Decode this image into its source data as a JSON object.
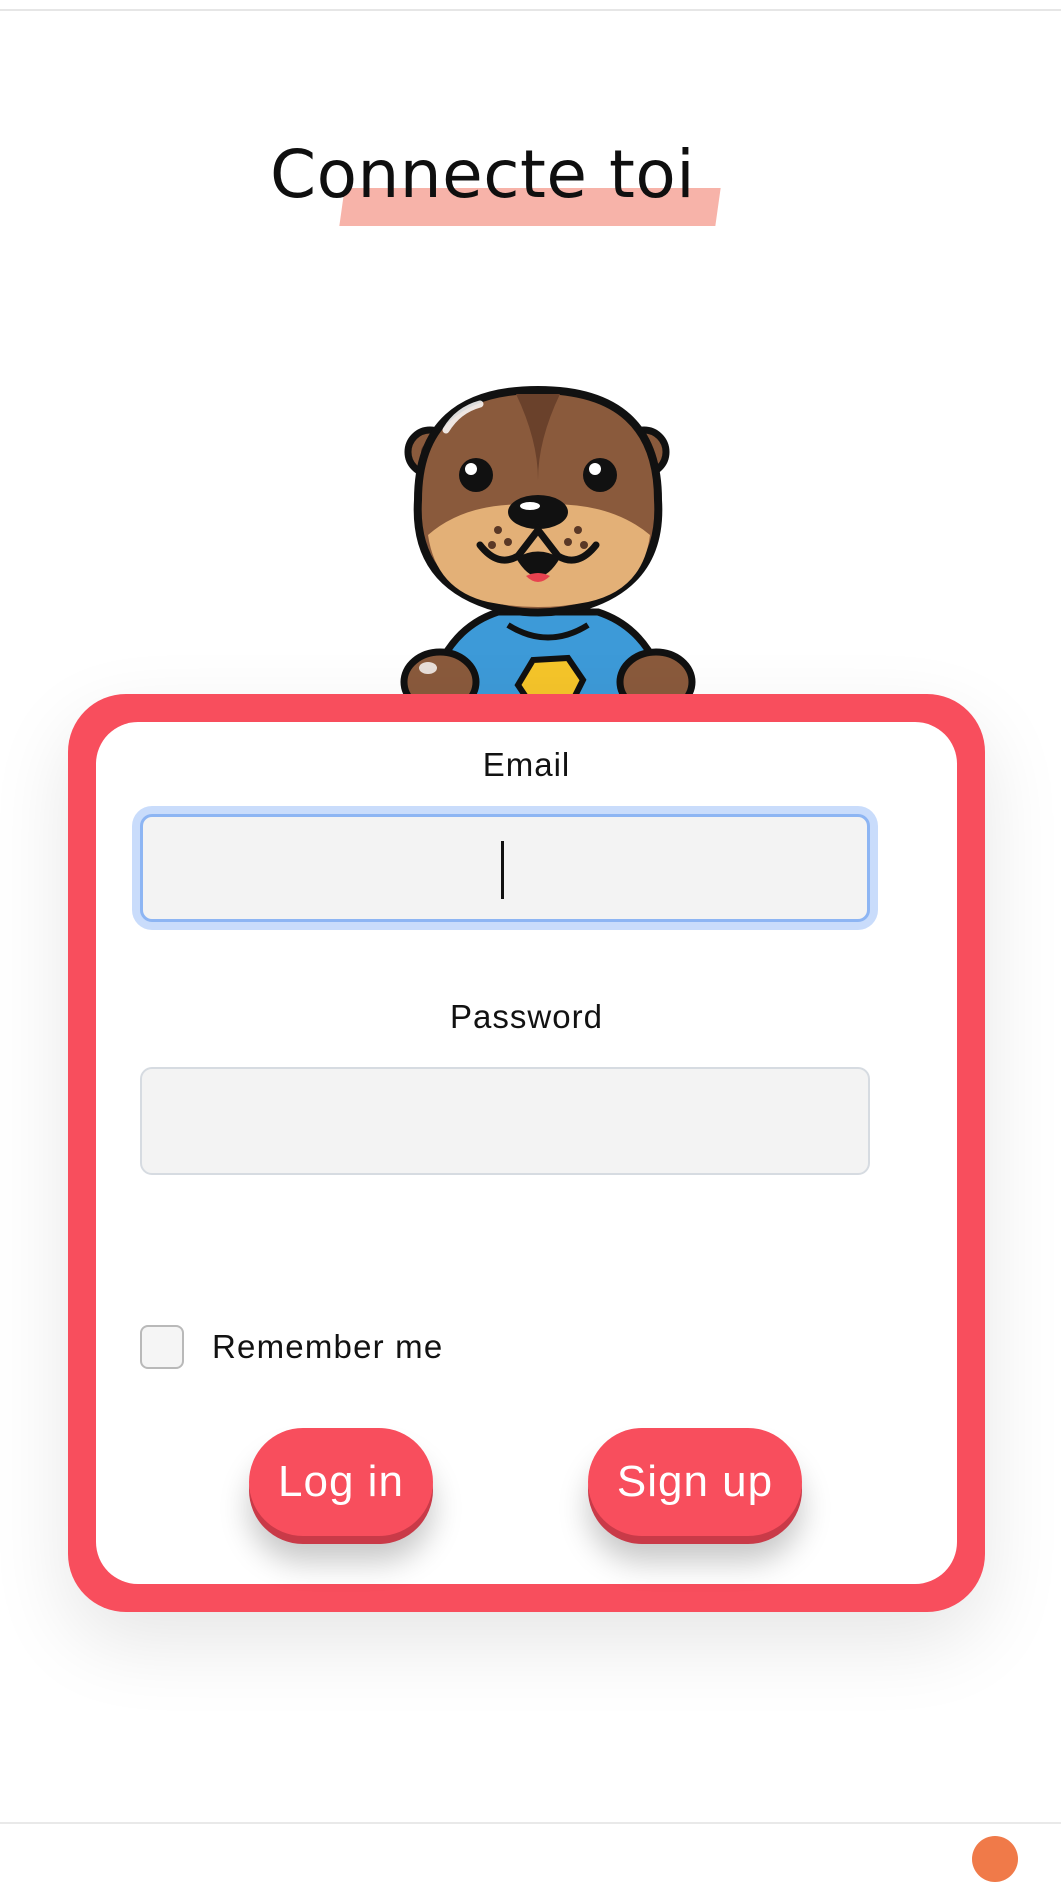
{
  "title": "Connecte toi",
  "mascot": {
    "icon": "otter-mascot-icon"
  },
  "form": {
    "email_label": "Email",
    "email_value": "",
    "password_label": "Password",
    "password_value": "",
    "remember_label": "Remember me",
    "remember_checked": false,
    "login_label": "Log in",
    "signup_label": "Sign up"
  },
  "colors": {
    "accent": "#f84e5d",
    "title_highlight": "#f7b3a9",
    "focus_ring": "#c9dcfb",
    "corner_dot": "#f07a49"
  }
}
